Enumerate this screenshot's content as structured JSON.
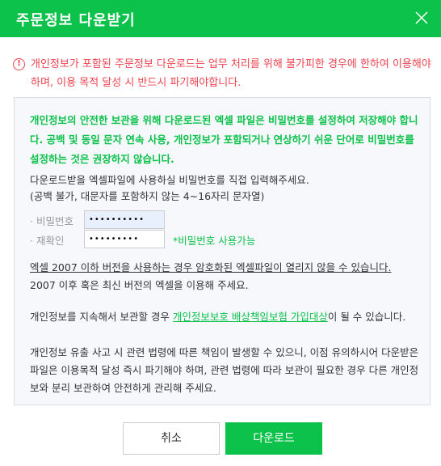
{
  "dialog": {
    "title": "주문정보 다운받기",
    "close_icon": "close-icon",
    "accent": "#0cc24b",
    "warning_color": "#f0434f"
  },
  "warning": {
    "icon": "exclamation-circle-icon",
    "text": "개인정보가 포함된 주문정보 다운로드는 업무 처리를 위해 불가피한 경우에 한하여 이용해야하며, 이용 목적 달성 시 반드시 파기해야합니다."
  },
  "box": {
    "notice": "개인정보의 안전한 보관을 위해 다운로드된 엑셀 파일은 비밀번호를 설정하여 저장해야 합니다. 공백 및 동일 문자 연속 사용, 개인정보가 포함되거나 연상하기 쉬운 단어로 비밀번호를 설정하는 것은 권장하지 않습니다.",
    "instruction1": "다운로드받을 엑셀파일에 사용하실 비밀번호를 직접 입력해주세요.",
    "instruction2": "(공백 불가, 대문자를 포함하지 않는 4~16자리 문자열)",
    "password_label": "· 비밀번호",
    "password_value": "••••••••••",
    "confirm_label": "· 재확인",
    "confirm_value": "•••••••••",
    "password_status": "*비밀번호 사용가능",
    "excel_note1": "엑셀 2007 이하 버전을 사용하는 경우 암호화된 엑셀파일이 열리지 않을 수 있습니다.",
    "excel_note2": "2007 이후 혹은 최신 버전의 엑셀을 이용해 주세요.",
    "keep_pre": "개인정보를 지속해서 보관할 경우 ",
    "keep_link": "개인정보보호 배상책임보험 가입대상",
    "keep_post": "이 될 수 있습니다.",
    "leak_note": "개인정보 유출 사고 시 관련 법령에 따른 책임이 발생할 수 있으니, 이점 유의하시어 다운받은 파일은 이용목적 달성 즉시 파기해야 하며, 관련 법령에 따라 보관이 필요한 경우 다른 개인정보와 분리 보관하여 안전하게 관리해 주세요."
  },
  "buttons": {
    "cancel": "취소",
    "download": "다운로드"
  }
}
